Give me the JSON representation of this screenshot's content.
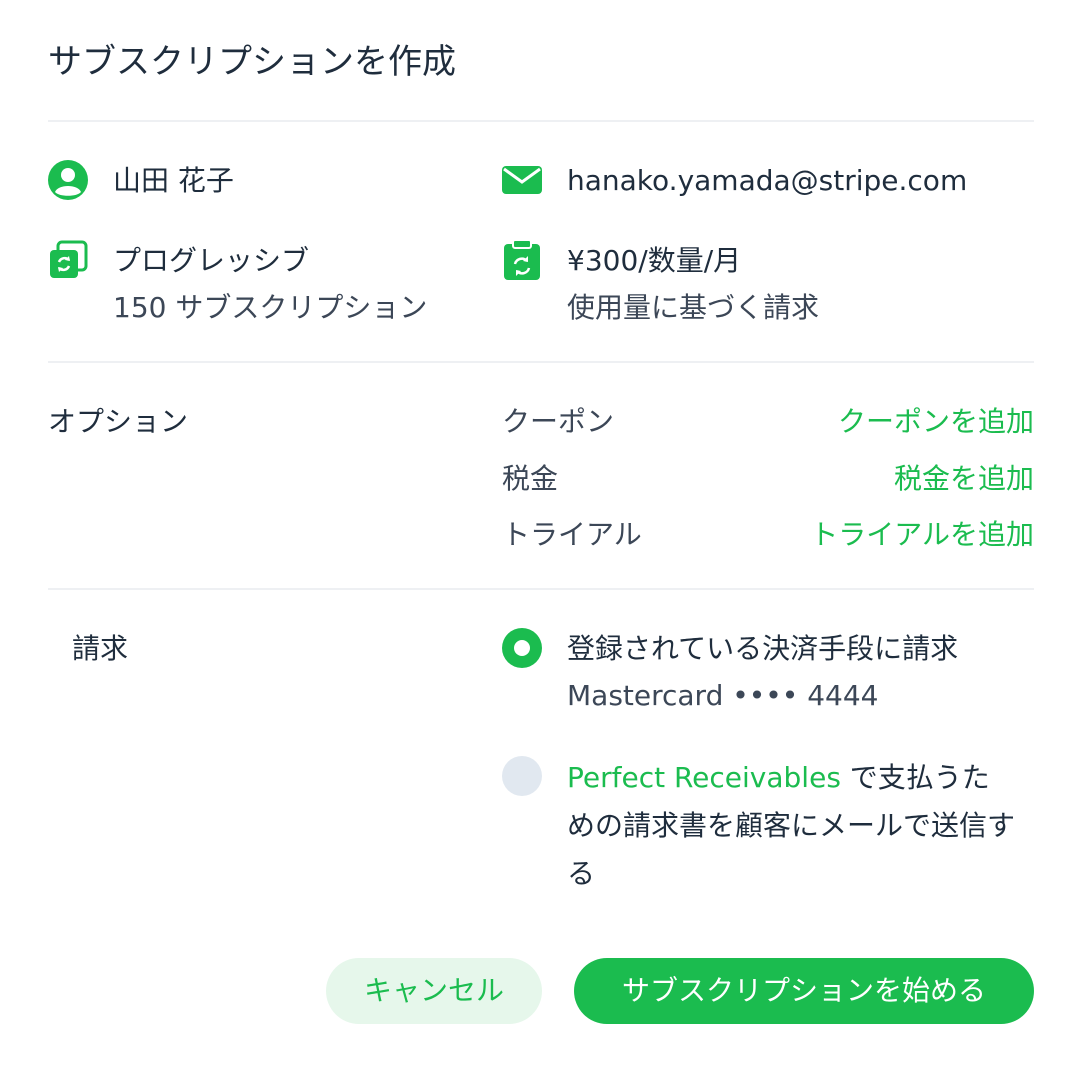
{
  "title": "サブスクリプションを作成",
  "customer": {
    "name": "山田 花子",
    "email": "hanako.yamada@stripe.com"
  },
  "plan": {
    "name": "プログレッシブ",
    "count": "150 サブスクリプション",
    "price": "¥300/数量/月",
    "billing_type": "使用量に基づく請求"
  },
  "options": {
    "section_label": "オプション",
    "rows": [
      {
        "label": "クーポン",
        "action": "クーポンを追加"
      },
      {
        "label": "税金",
        "action": "税金を追加"
      },
      {
        "label": "トライアル",
        "action": "トライアルを追加"
      }
    ]
  },
  "billing": {
    "section_label": "請求",
    "option1": {
      "label": "登録されている決済手段に請求",
      "card": "Mastercard •••• 4444",
      "selected": true
    },
    "option2": {
      "link": "Perfect Receivables",
      "text": " で支払うための請求書を顧客にメールで送信する",
      "selected": false
    }
  },
  "buttons": {
    "cancel": "キャンセル",
    "start": "サブスクリプションを始める"
  },
  "icons": {
    "person": "person-circle-icon",
    "mail": "envelope-icon",
    "plan": "subscription-stack-icon",
    "price": "clipboard-refresh-icon"
  },
  "colors": {
    "accent": "#1bbc4f",
    "text": "#1f2d3d",
    "divider": "#eef0f3",
    "cancel_bg": "#e6f7eb",
    "radio_off": "#e1e8f0"
  }
}
